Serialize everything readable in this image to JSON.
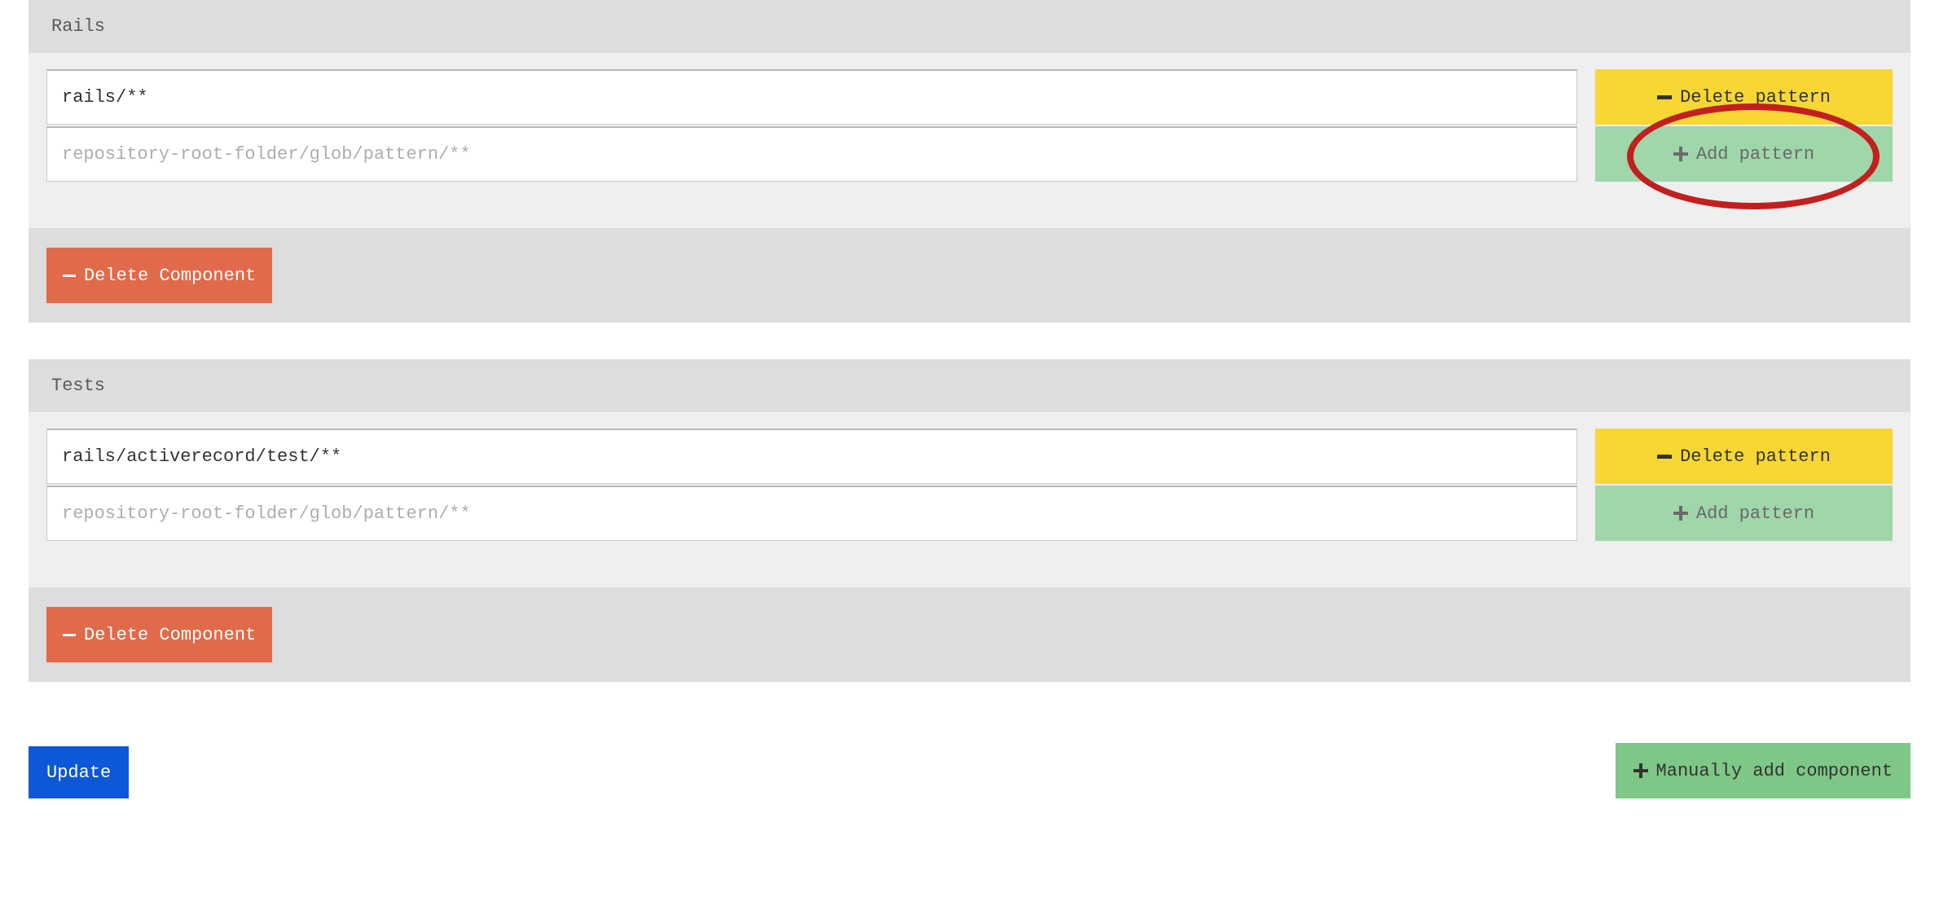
{
  "buttons": {
    "delete_pattern": "Delete pattern",
    "add_pattern": "Add pattern",
    "delete_component": "Delete Component",
    "manual_add_component": "Manually add component",
    "update": "Update"
  },
  "components": [
    {
      "name": "Rails",
      "patterns": [
        {
          "value": "rails/**"
        }
      ],
      "new_pattern_placeholder": "repository-root-folder/glob/pattern/**"
    },
    {
      "name": "Tests",
      "patterns": [
        {
          "value": "rails/activerecord/test/**"
        }
      ],
      "new_pattern_placeholder": "repository-root-folder/glob/pattern/**"
    }
  ]
}
